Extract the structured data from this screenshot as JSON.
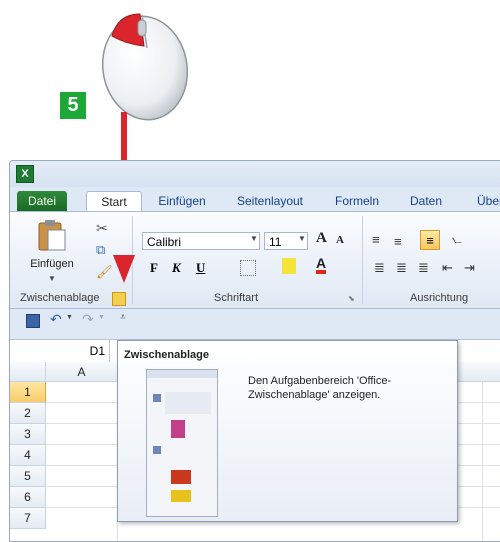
{
  "step_number": "5",
  "app_icon_letter": "X",
  "ribbon_tabs": [
    "Datei",
    "Start",
    "Einfügen",
    "Seitenlayout",
    "Formeln",
    "Daten",
    "Über"
  ],
  "clipboard": {
    "paste_label": "Einfügen",
    "group_label": "Zwischenablage"
  },
  "font": {
    "name": "Calibri",
    "size": "11",
    "group_label": "Schriftart",
    "bold": "F",
    "italic": "K",
    "underline": "U",
    "grow": "A",
    "shrink": "A"
  },
  "alignment": {
    "group_label": "Ausrichtung"
  },
  "formula_bar": {
    "name_box": "D1"
  },
  "columns": [
    "A"
  ],
  "rows": [
    "1",
    "2",
    "3",
    "4",
    "5",
    "6",
    "7"
  ],
  "tooltip": {
    "title": "Zwischenablage",
    "text": "Den Aufgabenbereich 'Office-Zwischenablage' anzeigen."
  },
  "colors": {
    "accent_red": "#d9252b",
    "step_green": "#1ea838",
    "excel_green": "#1e7b34"
  }
}
